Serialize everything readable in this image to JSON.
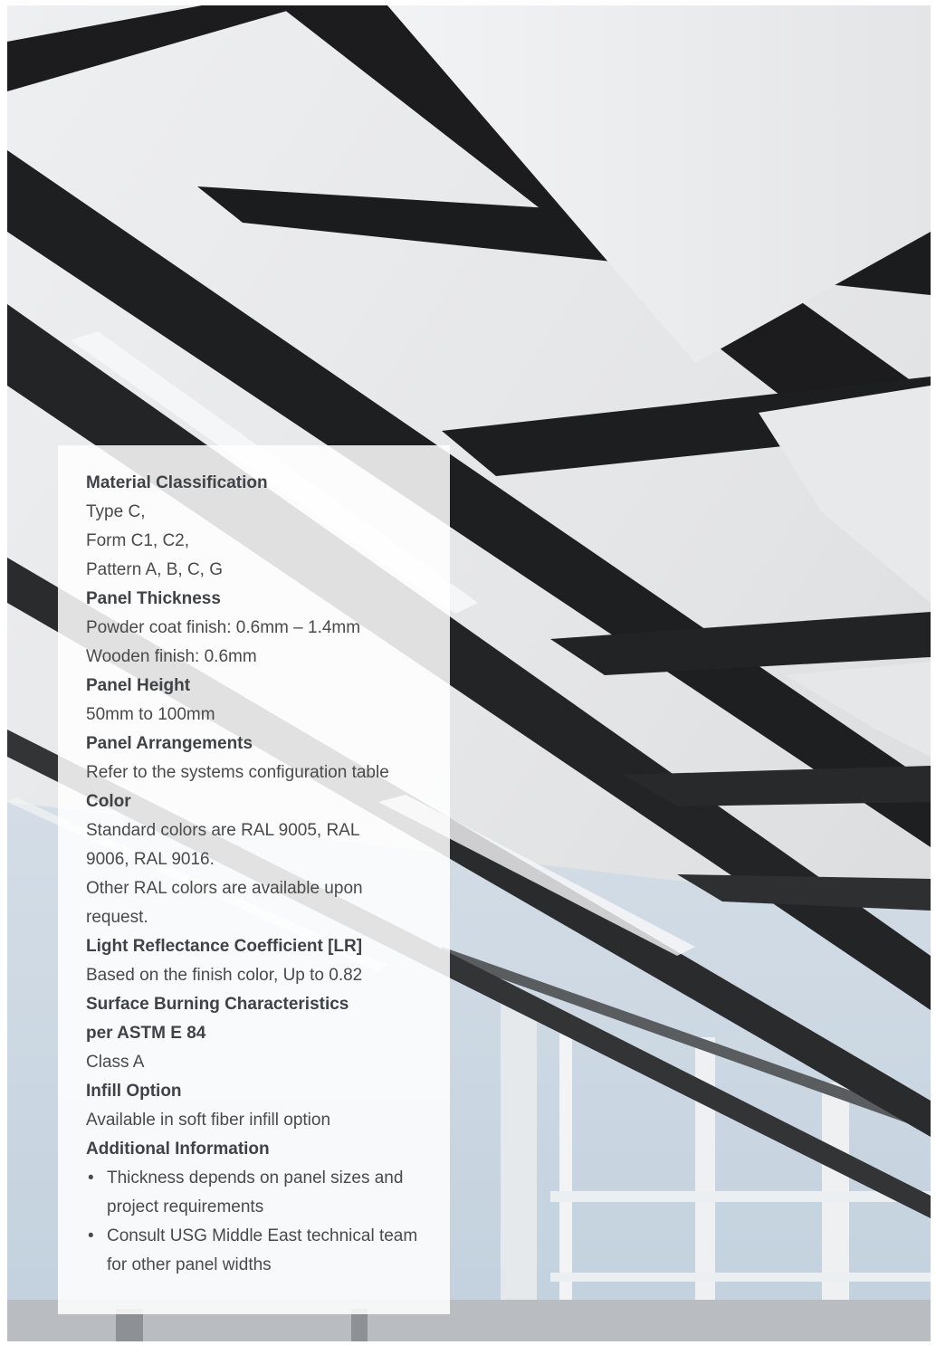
{
  "specs": {
    "material_classification": {
      "heading": "Material Classification",
      "lines": [
        "Type C,",
        "Form C1, C2,",
        "Pattern A, B, C, G"
      ]
    },
    "panel_thickness": {
      "heading": "Panel Thickness",
      "lines": [
        "Powder coat finish: 0.6mm – 1.4mm",
        "Wooden finish: 0.6mm"
      ]
    },
    "panel_height": {
      "heading": "Panel Height",
      "lines": [
        "50mm to 100mm"
      ]
    },
    "panel_arrangements": {
      "heading": "Panel Arrangements",
      "lines": [
        "Refer to the systems configuration table"
      ]
    },
    "color": {
      "heading": "Color",
      "lines": [
        "Standard colors are RAL 9005, RAL 9006, RAL 9016.",
        "Other RAL colors are available upon request."
      ]
    },
    "light_reflectance": {
      "heading": "Light Reflectance Coefficient [LR]",
      "lines": [
        "Based on the finish color, Up to 0.82"
      ]
    },
    "surface_burning": {
      "heading_line1": "Surface Burning Characteristics",
      "heading_line2": "per ASTM E 84",
      "lines": [
        "Class A"
      ]
    },
    "infill_option": {
      "heading": "Infill Option",
      "lines": [
        "Available in soft fiber infill option"
      ]
    },
    "additional_information": {
      "heading": "Additional Information",
      "bullet": "•",
      "items": [
        "Thickness depends on panel sizes and project requirements",
        "Consult USG Middle East technical team for other panel widths"
      ]
    }
  }
}
